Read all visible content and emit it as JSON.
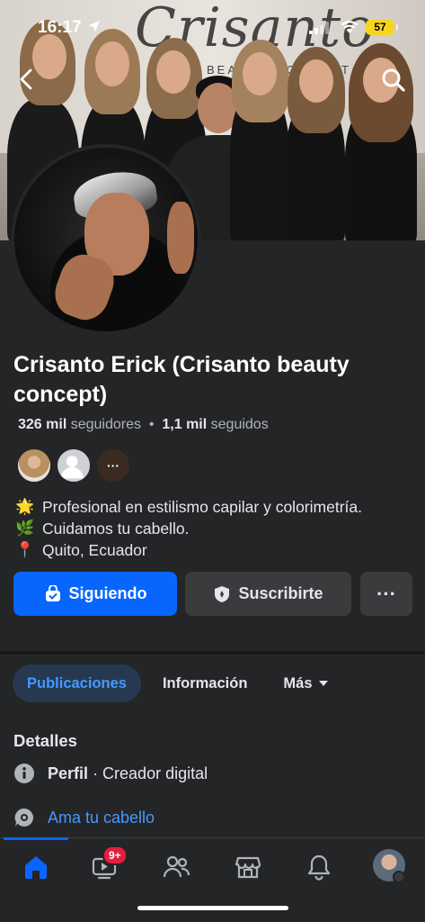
{
  "status_bar": {
    "time": "16:17",
    "battery": "57"
  },
  "cover": {
    "script_text": "Crisanto",
    "sub_text": "BEAUTY CONCEPT"
  },
  "profile": {
    "name": "Crisanto Erick (Crisanto beauty concept)",
    "followers_count": "326 mil",
    "followers_label": "seguidores",
    "following_count": "1,1 mil",
    "following_label": "seguidos",
    "separator": "•",
    "bio": [
      {
        "emoji": "🌟",
        "text": "Profesional en estilismo capilar y colorimetría."
      },
      {
        "emoji": "🌿",
        "text": "Cuidamos tu cabello."
      },
      {
        "emoji": "📍",
        "text": "Quito, Ecuador"
      }
    ]
  },
  "actions": {
    "following_label": "Siguiendo",
    "subscribe_label": "Suscribirte",
    "more_label": "···"
  },
  "tabs": [
    {
      "label": "Publicaciones",
      "active": true
    },
    {
      "label": "Información",
      "active": false
    },
    {
      "label": "Más",
      "active": false
    }
  ],
  "details": {
    "title": "Detalles",
    "profile_label": "Perfil",
    "profile_value": "· Creador digital",
    "link_text": "Ama tu cabello"
  },
  "bottom_nav": {
    "video_badge": "9+"
  },
  "colors": {
    "accent": "#0866ff",
    "link": "#4599ff",
    "background": "#242526",
    "badge": "#e41e3f"
  }
}
